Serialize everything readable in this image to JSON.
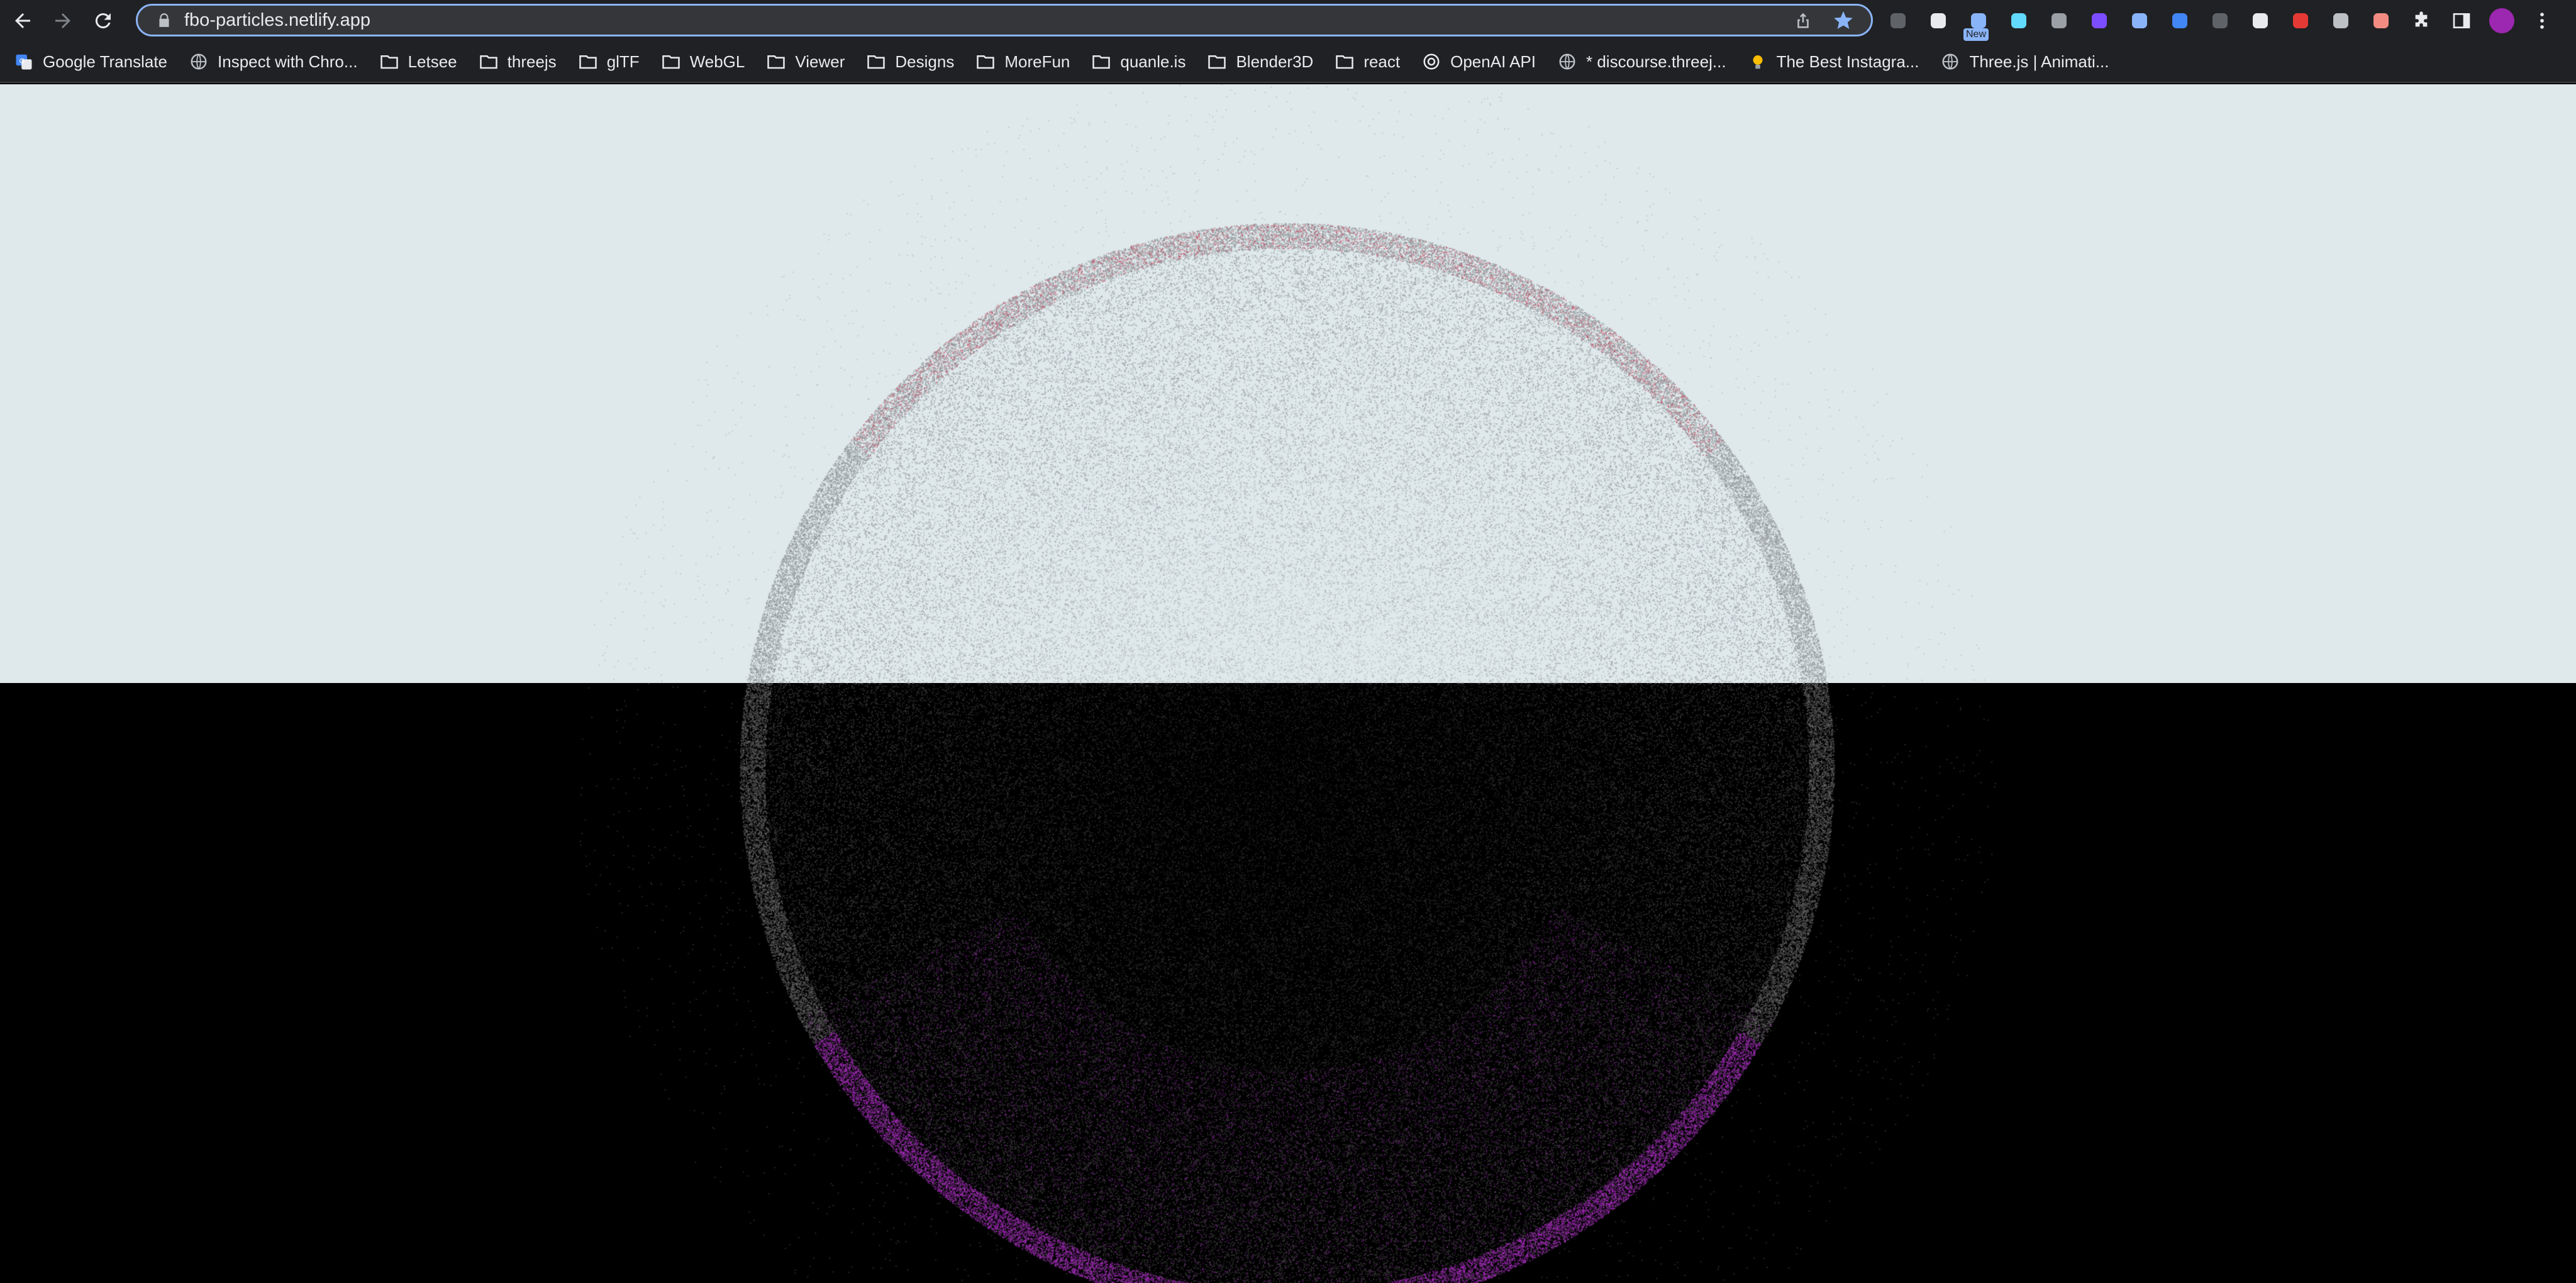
{
  "browser": {
    "url": "fbo-particles.netlify.app",
    "new_badge": "New",
    "nav": {
      "back": "back-arrow-icon",
      "forward": "forward-arrow-icon",
      "reload": "reload-icon"
    }
  },
  "bookmarks": [
    {
      "label": "Google Translate",
      "icon": "google-translate-icon"
    },
    {
      "label": "Inspect with Chro...",
      "icon": "globe-icon"
    },
    {
      "label": "Letsee",
      "icon": "folder-icon"
    },
    {
      "label": "threejs",
      "icon": "folder-icon"
    },
    {
      "label": "glTF",
      "icon": "folder-icon"
    },
    {
      "label": "WebGL",
      "icon": "folder-icon"
    },
    {
      "label": "Viewer",
      "icon": "folder-icon"
    },
    {
      "label": "Designs",
      "icon": "folder-icon"
    },
    {
      "label": "MoreFun",
      "icon": "folder-icon"
    },
    {
      "label": "quanle.is",
      "icon": "folder-icon"
    },
    {
      "label": "Blender3D",
      "icon": "folder-icon"
    },
    {
      "label": "react",
      "icon": "folder-icon"
    },
    {
      "label": "OpenAI API",
      "icon": "openai-icon"
    },
    {
      "label": "* discourse.threej...",
      "icon": "globe-icon"
    },
    {
      "label": "The Best Instagra...",
      "icon": "lightbulb-icon"
    },
    {
      "label": "Three.js | Animati...",
      "icon": "globe-icon"
    }
  ],
  "extensions": [
    {
      "name": "recycle-extension-icon",
      "color": "#5f6368"
    },
    {
      "name": "circle-extension-icon",
      "color": "#e8eaed"
    },
    {
      "name": "new-extension-icon",
      "color": "#8ab4f8"
    },
    {
      "name": "react-devtools-icon",
      "color": "#61dafb"
    },
    {
      "name": "signal-extension-icon",
      "color": "#9aa0a6"
    },
    {
      "name": "purple-extension-icon",
      "color": "#7c4dff"
    },
    {
      "name": "docs-extension-icon",
      "color": "#8ab4f8"
    },
    {
      "name": "diamond-extension-icon",
      "color": "#4285f4"
    },
    {
      "name": "screenshot-extension-icon",
      "color": "#5f6368"
    },
    {
      "name": "notion-icon",
      "color": "#e8eaed"
    },
    {
      "name": "red-extension-icon",
      "color": "#e53935"
    },
    {
      "name": "target-extension-icon",
      "color": "#bdc1c6"
    },
    {
      "name": "capsule-extension-icon",
      "color": "#f28b82"
    },
    {
      "name": "puzzle-icon",
      "color": "#e8eaed"
    },
    {
      "name": "side-panel-icon",
      "color": "#e8eaed"
    },
    {
      "name": "profile-avatar",
      "color": "#9c27b0"
    },
    {
      "name": "menu-kebab-icon",
      "color": "#e8eaed"
    }
  ],
  "scene": {
    "top_color": "#dfe9eb",
    "bottom_color": "#000000",
    "particle_color_light": "#9a9ea3",
    "particle_color_dark": "#3a3a3a",
    "accent_pink": "#c4475f",
    "accent_purple": "#b030c8"
  }
}
